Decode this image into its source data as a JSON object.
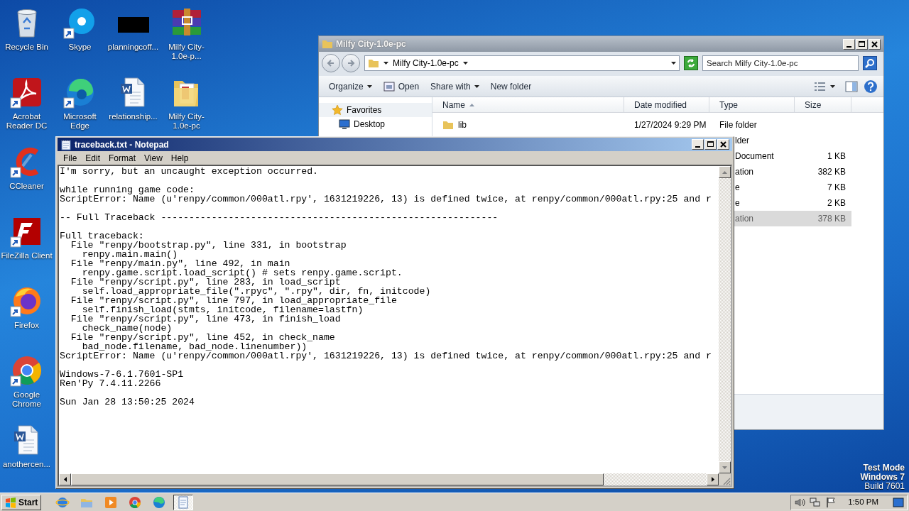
{
  "desktop_columns": [
    [
      {
        "label": "Recycle Bin",
        "kind": "recycle",
        "shortcut": false
      },
      {
        "label": "Acrobat Reader DC",
        "kind": "pdf",
        "shortcut": true
      },
      {
        "label": "CCleaner",
        "kind": "cleaner",
        "shortcut": true
      },
      {
        "label": "FileZilla Client",
        "kind": "ftp",
        "shortcut": true
      },
      {
        "label": "Firefox",
        "kind": "firefox",
        "shortcut": true
      },
      {
        "label": "Google Chrome",
        "kind": "chrome",
        "shortcut": true
      },
      {
        "label": "anothercen...",
        "kind": "word",
        "shortcut": false
      }
    ],
    [
      {
        "label": "Skype",
        "kind": "chat",
        "shortcut": true
      },
      {
        "label": "Microsoft Edge",
        "kind": "edge",
        "shortcut": true
      }
    ],
    [
      {
        "label": "planningcoff...",
        "kind": "black",
        "shortcut": false
      },
      {
        "label": "relationship...",
        "kind": "word",
        "shortcut": false
      }
    ],
    [
      {
        "label": "Milfy City-1.0e-p...",
        "kind": "archive",
        "shortcut": false
      },
      {
        "label": "Milfy City-1.0e-pc",
        "kind": "folder",
        "shortcut": false
      }
    ]
  ],
  "explorer": {
    "title": "Milfy City-1.0e-pc",
    "breadcrumb": "Milfy City-1.0e-pc",
    "search": {
      "placeholder": "Search Milfy City-1.0e-pc"
    },
    "toolbar": [
      {
        "label": "Organize",
        "kind": "menu"
      },
      {
        "label": "Open",
        "kind": "icon"
      },
      {
        "label": "Share with",
        "kind": "menu"
      },
      {
        "label": "New folder",
        "kind": "plain"
      }
    ],
    "nav": [
      {
        "label": "Favorites",
        "kind": "star"
      },
      {
        "label": "Desktop",
        "kind": "desktop"
      }
    ],
    "columns": [
      {
        "label": "Name",
        "sorted": true
      },
      {
        "label": "Date modified",
        "sorted": false
      },
      {
        "label": "Type",
        "sorted": false
      },
      {
        "label": "Size",
        "sorted": false
      }
    ],
    "rows": [
      {
        "name": "lib",
        "date": "1/27/2024 9:29 PM",
        "type": "File folder",
        "selected": false
      },
      {
        "type": "lder",
        "selected": false
      },
      {
        "type": "Document",
        "size": "1 KB",
        "selected": false
      },
      {
        "type": "ation",
        "size": "382 KB",
        "selected": false
      },
      {
        "type": "e",
        "size": "7 KB",
        "selected": false
      },
      {
        "type": "e",
        "size": "2 KB",
        "selected": false
      },
      {
        "type": "ation",
        "size": "378 KB",
        "selected": true
      }
    ]
  },
  "notepad": {
    "title": "traceback.txt - Notepad",
    "menu": [
      "File",
      "Edit",
      "Format",
      "View",
      "Help"
    ],
    "blocks": [
      [
        "I'm sorry, but an uncaught exception occurred."
      ],
      [
        "while running game code:",
        "ScriptError: Name (u'renpy/common/000atl.rpy', 1631219226, 13) is defined twice, at renpy/common/000atl.rpy:25 and r"
      ],
      [
        "-- Full Traceback ------------------------------------------------------------"
      ],
      [
        "Full traceback:",
        "  File \"renpy/bootstrap.py\", line 331, in bootstrap",
        "    renpy.main.main()",
        "  File \"renpy/main.py\", line 492, in main",
        "    renpy.game.script.load_script() # sets renpy.game.script.",
        "  File \"renpy/script.py\", line 283, in load_script",
        "    self.load_appropriate_file(\".rpyc\", \".rpy\", dir, fn, initcode)",
        "  File \"renpy/script.py\", line 797, in load_appropriate_file",
        "    self.finish_load(stmts, initcode, filename=lastfn)",
        "  File \"renpy/script.py\", line 473, in finish_load",
        "    check_name(node)",
        "  File \"renpy/script.py\", line 452, in check_name",
        "    bad_node.filename, bad_node.linenumber))",
        "ScriptError: Name (u'renpy/common/000atl.rpy', 1631219226, 13) is defined twice, at renpy/common/000atl.rpy:25 and r"
      ],
      [
        "Windows-7-6.1.7601-SP1",
        "Ren'Py 7.4.11.2266"
      ],
      [
        "Sun Jan 28 13:50:25 2024"
      ]
    ]
  },
  "os_notice": [
    "Test Mode",
    "Windows 7",
    "Build 7601"
  ],
  "taskbar": {
    "start": "Start",
    "apps": [
      {
        "kind": "ie",
        "selected": false
      },
      {
        "kind": "explorer",
        "selected": false
      },
      {
        "kind": "media",
        "selected": false
      },
      {
        "kind": "chrome",
        "selected": false
      },
      {
        "kind": "edge",
        "selected": false
      },
      {
        "kind": "notepad",
        "selected": true
      }
    ],
    "clock": "1:50 PM"
  }
}
